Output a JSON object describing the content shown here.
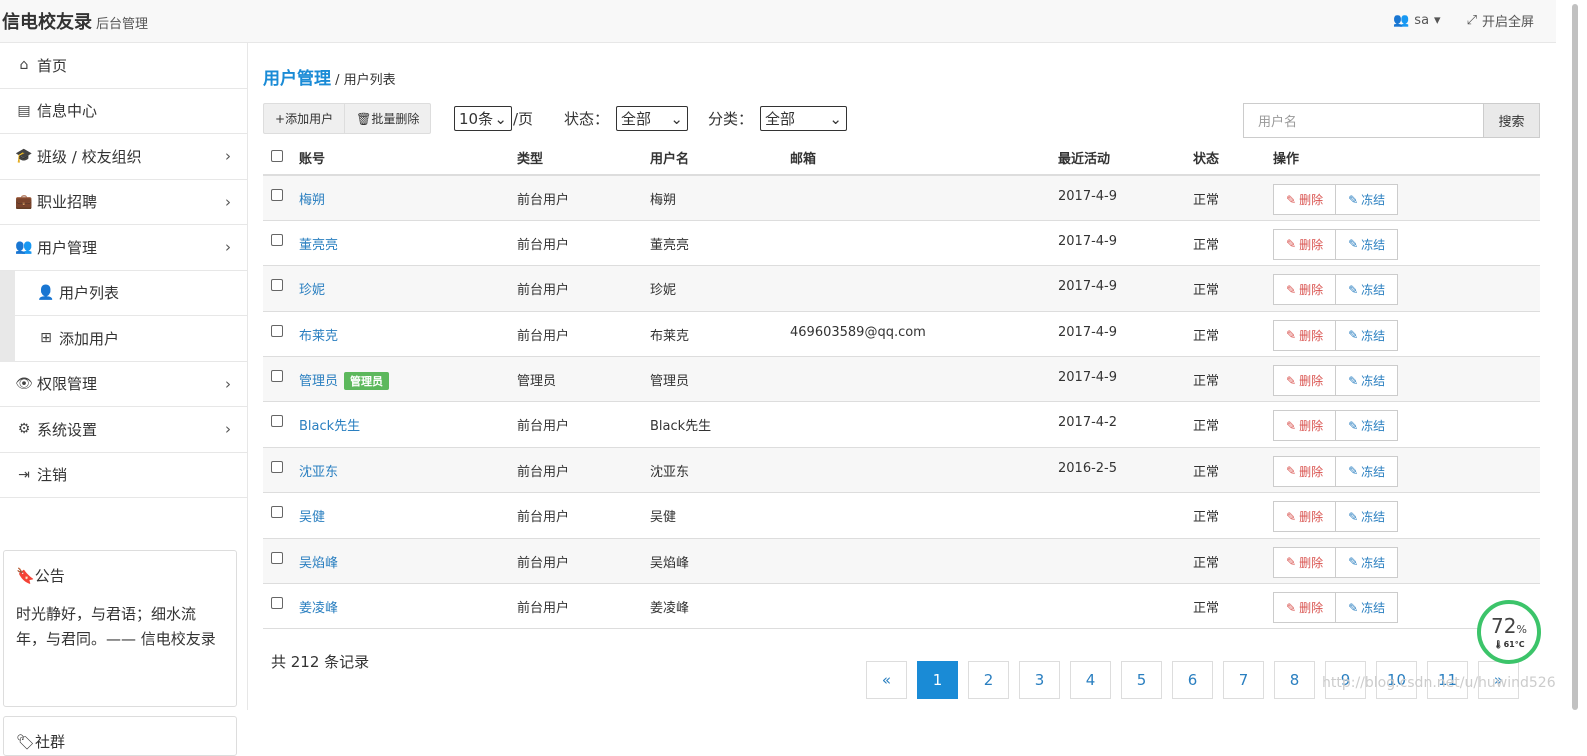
{
  "topbar": {
    "brand": "信电校友录",
    "subtitle": "后台管理",
    "user": "sa",
    "fullscreen": "开启全屏"
  },
  "sidebar": {
    "items": [
      {
        "label": "首页",
        "icon": "home-icon"
      },
      {
        "label": "信息中心",
        "icon": "newspaper-icon"
      },
      {
        "label": "班级 / 校友组织",
        "icon": "graduation-cap-icon"
      },
      {
        "label": "职业招聘",
        "icon": "briefcase-icon"
      },
      {
        "label": "用户管理",
        "icon": "users-icon"
      }
    ],
    "subitems": [
      {
        "label": "用户列表",
        "icon": "user-icon"
      },
      {
        "label": "添加用户",
        "icon": "plus-square-icon"
      }
    ],
    "items2": [
      {
        "label": "权限管理",
        "icon": "eye-icon"
      },
      {
        "label": "系统设置",
        "icon": "gears-icon"
      },
      {
        "label": "注销",
        "icon": "sign-out-icon"
      }
    ]
  },
  "notice": {
    "title": "公告",
    "text": "时光静好，与君语；细水流年，与君同。—— 信电校友录"
  },
  "community": {
    "title": "社群"
  },
  "breadcrumb": {
    "section": "用户管理",
    "page": "/ 用户列表"
  },
  "toolbar": {
    "add_label": "添加用户",
    "batch_delete_label": "批量删除",
    "page_size": "10条",
    "per_page_suffix": "/页",
    "status_label": "状态：",
    "status_value": "全部",
    "category_label": "分类：",
    "category_value": "全部",
    "search_placeholder": "用户名",
    "search_button": "搜索"
  },
  "table": {
    "headers": [
      "账号",
      "类型",
      "用户名",
      "邮箱",
      "最近活动",
      "状态",
      "操作"
    ],
    "delete_label": "删除",
    "freeze_label": "冻结",
    "admin_badge": "管理员",
    "rows": [
      {
        "account": "梅朔",
        "type": "前台用户",
        "username": "梅朔",
        "email": "",
        "last": "2017-4-9",
        "status": "正常"
      },
      {
        "account": "董亮亮",
        "type": "前台用户",
        "username": "董亮亮",
        "email": "",
        "last": "2017-4-9",
        "status": "正常"
      },
      {
        "account": "珍妮",
        "type": "前台用户",
        "username": "珍妮",
        "email": "",
        "last": "2017-4-9",
        "status": "正常"
      },
      {
        "account": "布莱克",
        "type": "前台用户",
        "username": "布莱克",
        "email": "469603589@qq.com",
        "last": "2017-4-9",
        "status": "正常"
      },
      {
        "account": "管理员",
        "type": "管理员",
        "username": "管理员",
        "email": "",
        "last": "2017-4-9",
        "status": "正常",
        "admin": true
      },
      {
        "account": "Black先生",
        "type": "前台用户",
        "username": "Black先生",
        "email": "",
        "last": "2017-4-2",
        "status": "正常"
      },
      {
        "account": "沈亚东",
        "type": "前台用户",
        "username": "沈亚东",
        "email": "",
        "last": "2016-2-5",
        "status": "正常"
      },
      {
        "account": "吴健",
        "type": "前台用户",
        "username": "吴健",
        "email": "",
        "last": "",
        "status": "正常"
      },
      {
        "account": "吴焰峰",
        "type": "前台用户",
        "username": "吴焰峰",
        "email": "",
        "last": "",
        "status": "正常"
      },
      {
        "account": "姜凌峰",
        "type": "前台用户",
        "username": "姜凌峰",
        "email": "",
        "last": "",
        "status": "正常"
      }
    ]
  },
  "total_text": "共 212 条记录",
  "pagination": {
    "prev": "«",
    "pages": [
      "1",
      "2",
      "3",
      "4",
      "5",
      "6",
      "7",
      "8",
      "9",
      "10",
      "11"
    ],
    "next": "»",
    "active": "1"
  },
  "watermark": "http://blog.csdn.net/u/huwind526",
  "monitor": {
    "percent": "72",
    "percent_unit": "%",
    "temp": "61°C"
  }
}
